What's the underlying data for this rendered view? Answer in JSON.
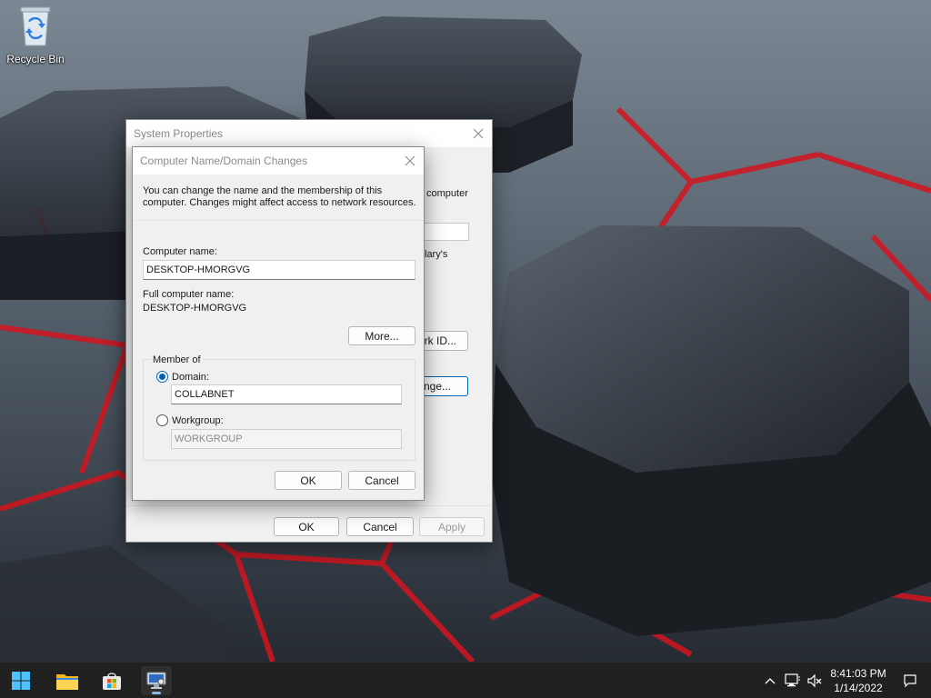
{
  "desktop": {
    "icons": [
      {
        "label": "Recycle Bin",
        "icon": "recycle-bin-icon"
      }
    ]
  },
  "system_properties": {
    "title": "System Properties",
    "fragments": {
      "computer_tail": "computer",
      "clarys_tail": "lary's",
      "network_id_tail": "ork ID...",
      "change_tail": "nge..."
    },
    "buttons": {
      "ok": "OK",
      "cancel": "Cancel",
      "apply": "Apply"
    }
  },
  "computer_name_dialog": {
    "title": "Computer Name/Domain Changes",
    "description_line1": "You can change the name and the membership of this",
    "description_line2": "computer. Changes might affect access to network resources.",
    "computer_name_label": "Computer name:",
    "computer_name_value": "DESKTOP-HMORGVG",
    "full_name_label": "Full computer name:",
    "full_name_value": "DESKTOP-HMORGVG",
    "more_button": "More...",
    "member_of": {
      "legend": "Member of",
      "domain_label": "Domain:",
      "domain_value": "COLLABNET",
      "domain_selected": true,
      "workgroup_label": "Workgroup:",
      "workgroup_value": "WORKGROUP"
    },
    "buttons": {
      "ok": "OK",
      "cancel": "Cancel"
    }
  },
  "taskbar": {
    "apps": [
      {
        "name": "start",
        "icon": "windows-start-icon"
      },
      {
        "name": "file-explorer",
        "icon": "file-explorer-icon"
      },
      {
        "name": "microsoft-store",
        "icon": "store-icon"
      },
      {
        "name": "system-properties",
        "icon": "system-properties-icon",
        "active": true
      }
    ],
    "tray": {
      "icons": [
        "chevron-up-icon",
        "network-icon",
        "volume-muted-icon",
        "notification-icon"
      ],
      "time": "8:41:03 PM",
      "date": "1/14/2022"
    }
  },
  "colors": {
    "accent": "#0063b1",
    "taskbar": "#202020",
    "dialog_bg": "#f0f0f0"
  }
}
